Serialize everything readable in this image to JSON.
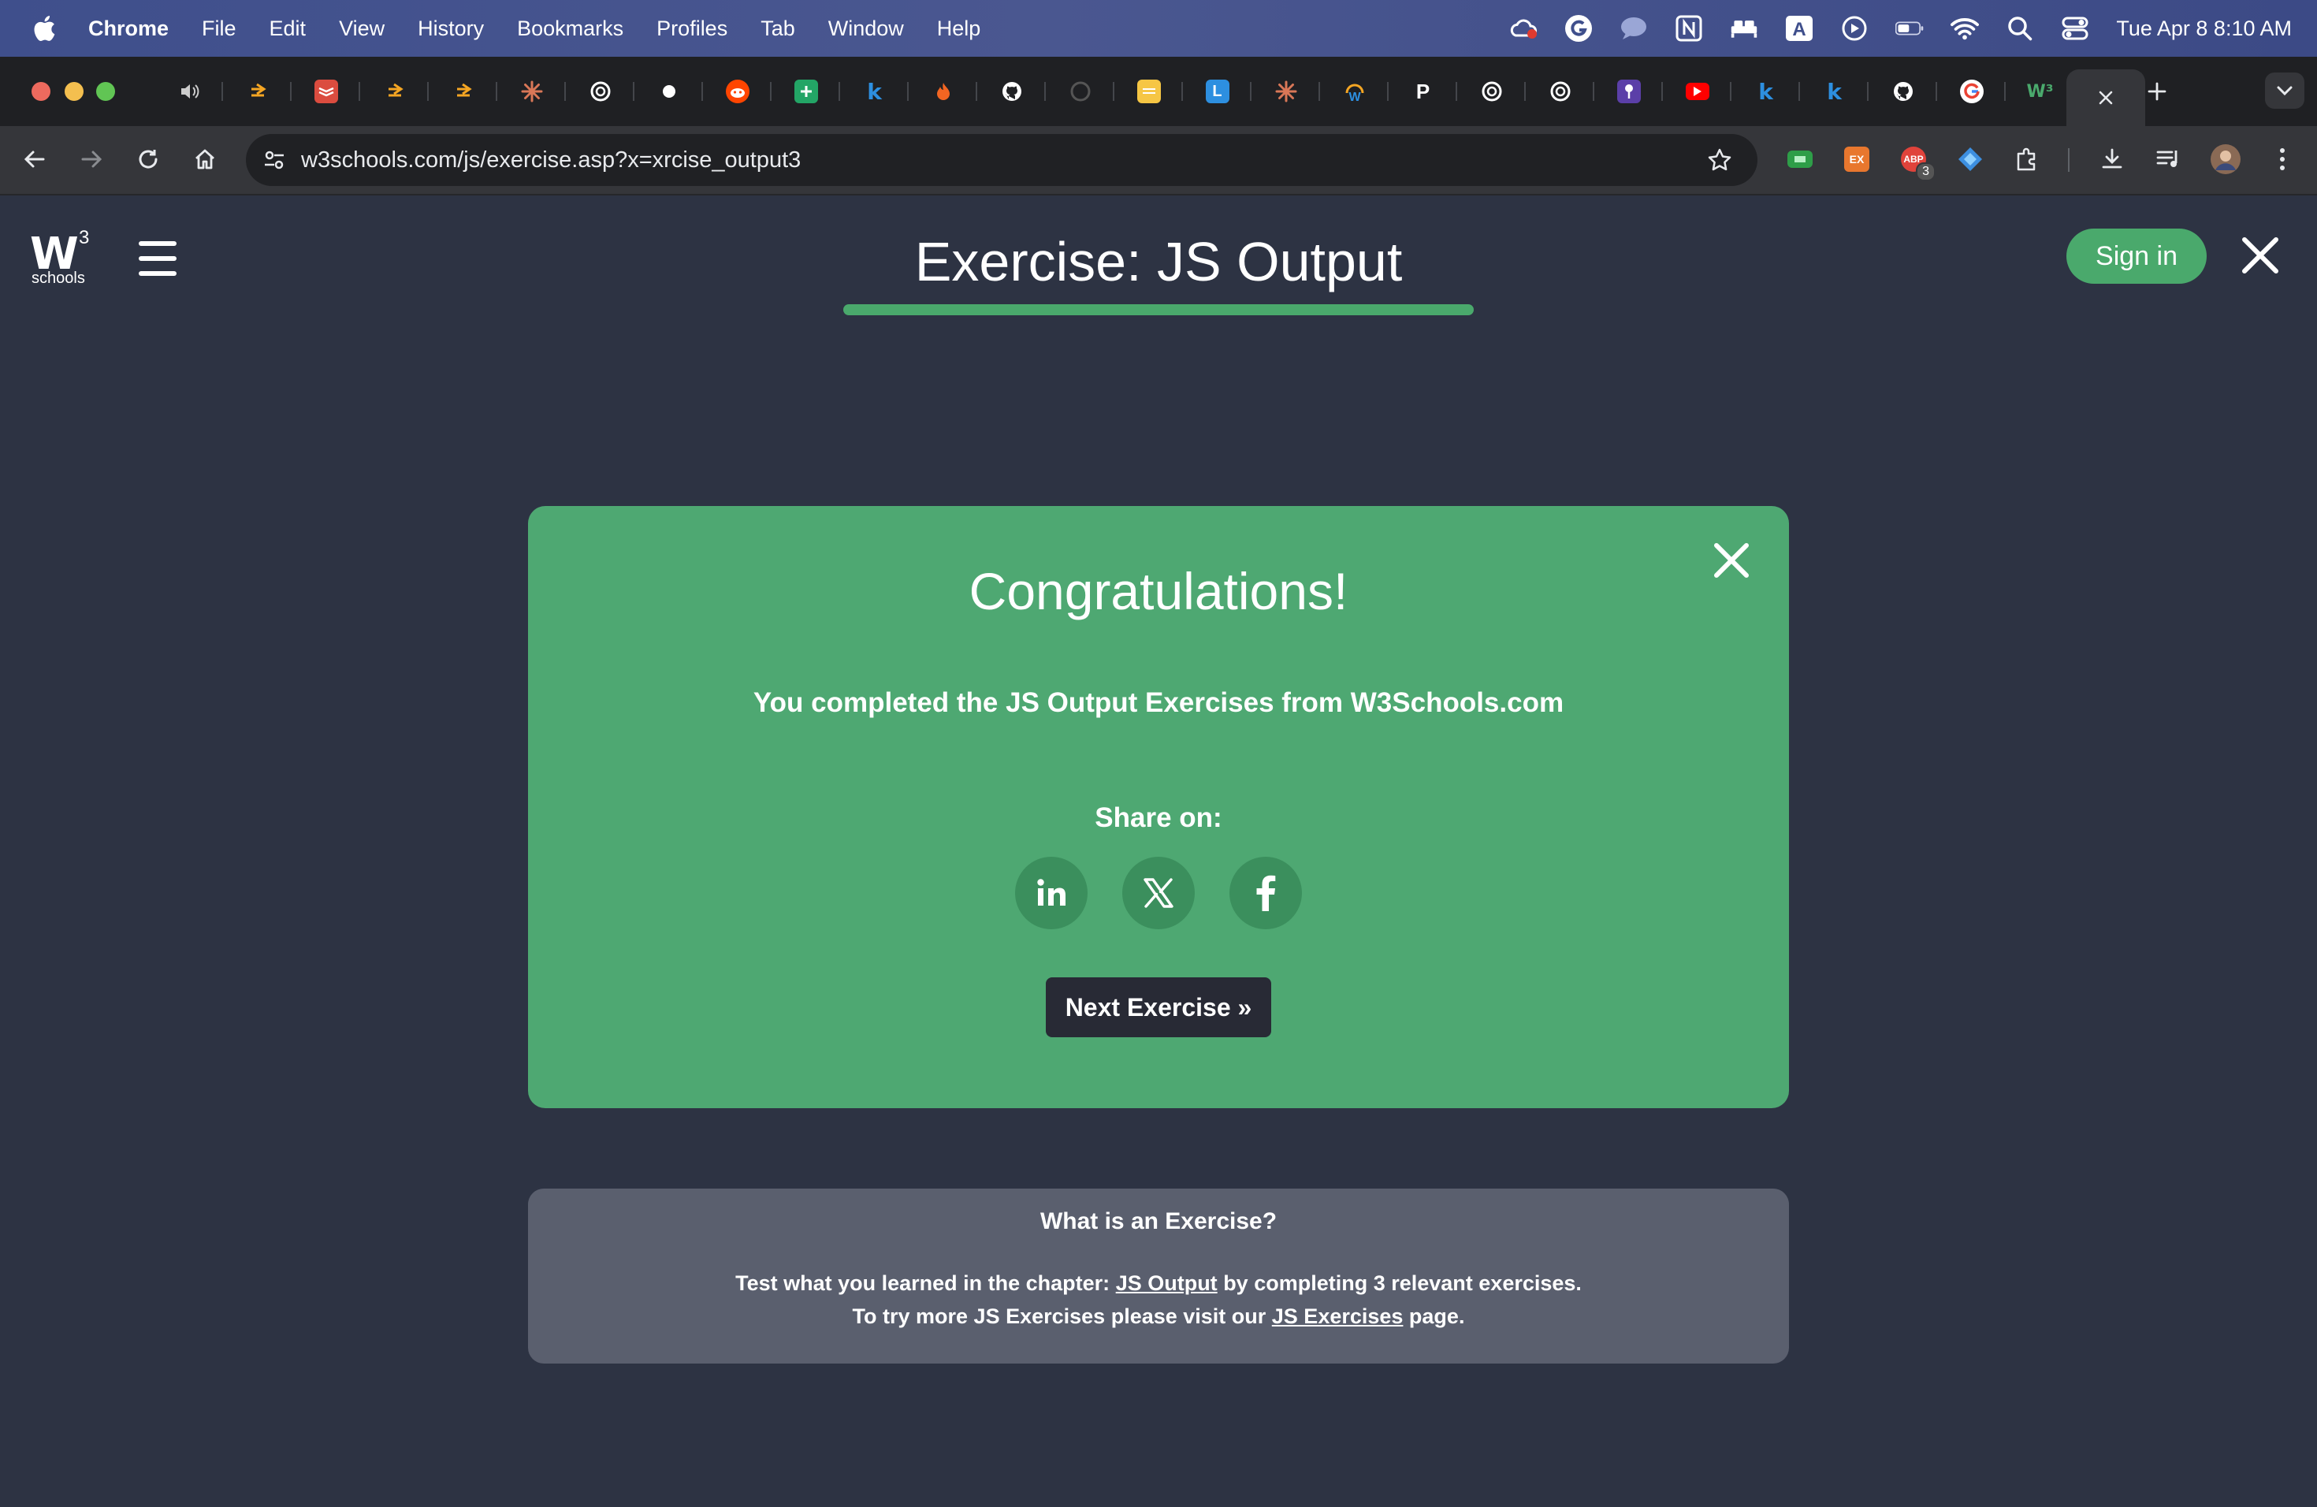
{
  "menubar": {
    "app_name": "Chrome",
    "items": [
      "File",
      "Edit",
      "View",
      "History",
      "Bookmarks",
      "Profiles",
      "Tab",
      "Window",
      "Help"
    ],
    "clock": "Tue Apr 8  8:10 AM"
  },
  "browser": {
    "url": "w3schools.com/js/exercise.asp?x=xrcise_output3",
    "extension_badge": "3",
    "extension_ex_label": "EX"
  },
  "tabs": [
    {
      "icon": "speaker-icon"
    },
    {
      "icon": "arrow-favicon-icon"
    },
    {
      "icon": "todoist-icon"
    },
    {
      "icon": "arrow-favicon-icon"
    },
    {
      "icon": "arrow-favicon-icon"
    },
    {
      "icon": "claude-icon"
    },
    {
      "icon": "openai-icon"
    },
    {
      "icon": "dot-icon"
    },
    {
      "icon": "reddit-icon"
    },
    {
      "icon": "sheets-icon"
    },
    {
      "icon": "k-icon"
    },
    {
      "icon": "fire-icon"
    },
    {
      "icon": "github-icon"
    },
    {
      "icon": "circle-icon"
    },
    {
      "icon": "notes-icon"
    },
    {
      "icon": "l-icon"
    },
    {
      "icon": "claude-icon"
    },
    {
      "icon": "w-icon"
    },
    {
      "icon": "p-icon"
    },
    {
      "icon": "openai-icon"
    },
    {
      "icon": "openai-icon"
    },
    {
      "icon": "pin-icon"
    },
    {
      "icon": "youtube-icon"
    },
    {
      "icon": "k-icon"
    },
    {
      "icon": "k-icon"
    },
    {
      "icon": "github-icon"
    },
    {
      "icon": "google-icon"
    },
    {
      "icon": "w3schools-icon"
    }
  ],
  "site": {
    "logo_text": "W",
    "logo_sup": "3",
    "logo_sub": "schools",
    "title": "Exercise: JS Output",
    "progress": 1.0,
    "sign_in": "Sign in",
    "accent": "#4aa96c"
  },
  "congrats": {
    "title": "Congratulations!",
    "message": "You completed the JS Output Exercises from W3Schools.com",
    "share_label": "Share on:",
    "share": [
      "linkedin-icon",
      "x-icon",
      "facebook-icon"
    ],
    "next": "Next Exercise »"
  },
  "info": {
    "title": "What is an Exercise?",
    "line1_pre": "Test what you learned in the chapter: ",
    "line1_link": "JS Output",
    "line1_post": " by completing 3 relevant exercises.",
    "line2_pre": "To try more JS Exercises please visit our ",
    "line2_link": "JS Exercises",
    "line2_post": " page."
  }
}
